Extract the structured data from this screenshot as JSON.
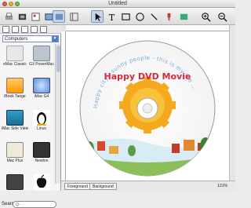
{
  "window": {
    "title": "Untitled"
  },
  "toolbar": {
    "tools": [
      {
        "name": "arrow-tool",
        "glyph": "➤"
      },
      {
        "name": "text-tool",
        "glyph": "T"
      },
      {
        "name": "rectangle-tool",
        "glyph": "▭"
      },
      {
        "name": "ellipse-tool",
        "glyph": "◯"
      },
      {
        "name": "line-tool",
        "glyph": "╲"
      }
    ]
  },
  "sidebar": {
    "category": "Computers",
    "items": [
      {
        "label": "eMac Classic"
      },
      {
        "label": "G3 PowerMac"
      },
      {
        "label": "iBook Tange"
      },
      {
        "label": "iMac G4"
      },
      {
        "label": "iMac Side View"
      },
      {
        "label": "Linux"
      },
      {
        "label": "Mac Plus"
      },
      {
        "label": "Newton"
      }
    ],
    "search_label": "Search",
    "search_placeholder": "Q-"
  },
  "disc": {
    "title": "Happy DVD Movie",
    "arc_text": "Happy city - sunny people - this is my life ..."
  },
  "bottom": {
    "tab_foreground": "Foreground",
    "tab_background": "Background",
    "zoom": "121%"
  }
}
